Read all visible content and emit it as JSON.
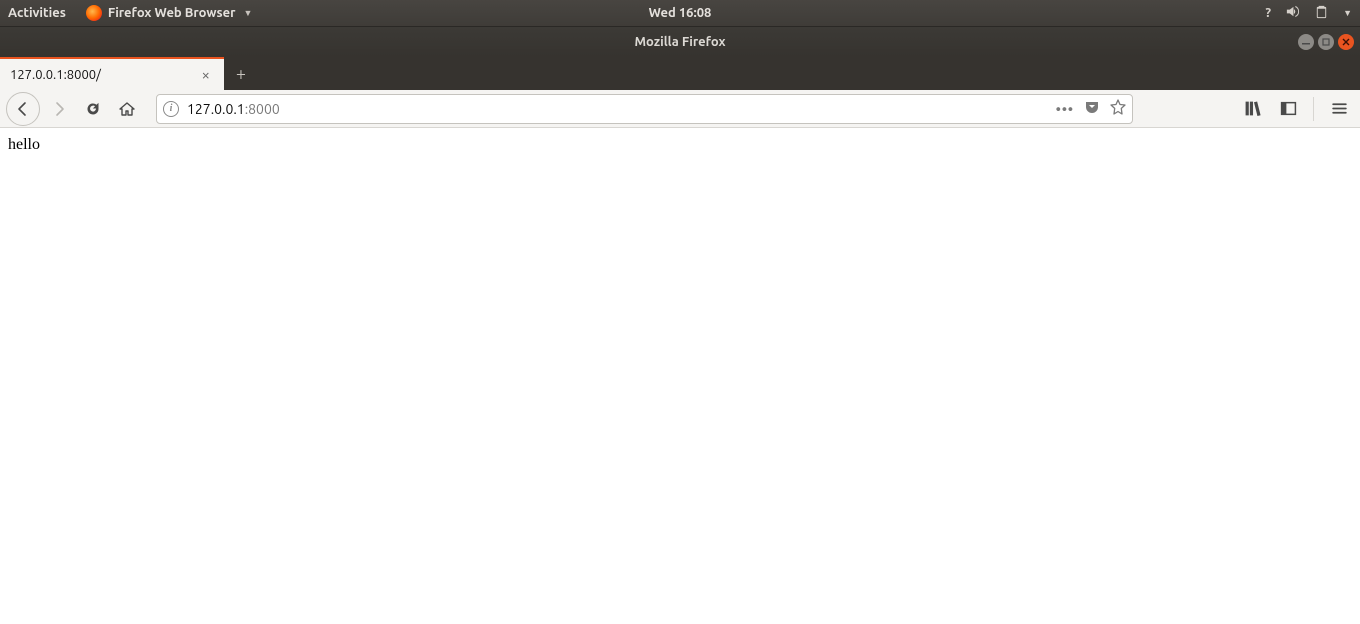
{
  "gnome": {
    "activities": "Activities",
    "app_name": "Firefox Web Browser",
    "clock": "Wed 16:08"
  },
  "window": {
    "title": "Mozilla Firefox"
  },
  "tabs": [
    {
      "label": "127.0.0.1:8000/"
    }
  ],
  "url": {
    "host": "127.0.0.1",
    "port": ":8000"
  },
  "page": {
    "body": "hello"
  }
}
